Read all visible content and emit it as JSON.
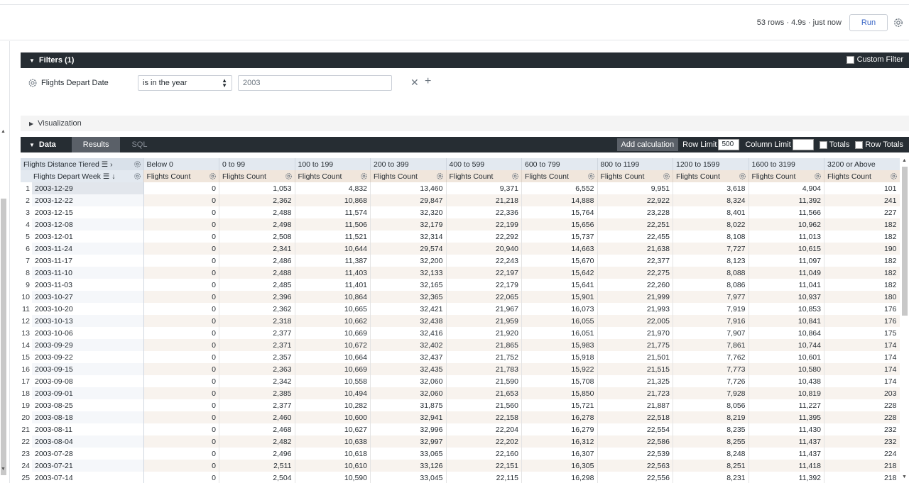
{
  "toolbar": {
    "status": "53 rows · 4.9s · just now",
    "run_label": "Run"
  },
  "filters": {
    "title": "Filters (1)",
    "custom_filter_label": "Custom Filter",
    "field_label": "Flights Depart Date",
    "operator": "is in the year",
    "value": "2003"
  },
  "visualization": {
    "title": "Visualization"
  },
  "data_panel": {
    "title": "Data",
    "tabs": [
      "Results",
      "SQL"
    ],
    "add_calculation": "Add calculation",
    "row_limit_label": "Row Limit",
    "row_limit_value": "500",
    "column_limit_label": "Column Limit",
    "column_limit_value": "",
    "totals_label": "Totals",
    "row_totals_label": "Row Totals"
  },
  "table": {
    "pivot_dimension": "Flights Distance Tiered",
    "row_dimension": "Flights Depart Week",
    "pivot_columns": [
      "Below 0",
      "0 to 99",
      "100 to 199",
      "200 to 399",
      "400 to 599",
      "600 to 799",
      "800 to 1199",
      "1200 to 1599",
      "1600 to 3199",
      "3200 or Above"
    ],
    "measure": "Flights Count",
    "rows": [
      {
        "i": "1",
        "week": "2003-12-29",
        "v": [
          "0",
          "1,053",
          "4,832",
          "13,460",
          "9,371",
          "6,552",
          "9,951",
          "3,618",
          "4,904",
          "101"
        ]
      },
      {
        "i": "2",
        "week": "2003-12-22",
        "v": [
          "0",
          "2,362",
          "10,868",
          "29,847",
          "21,218",
          "14,888",
          "22,922",
          "8,324",
          "11,392",
          "241"
        ]
      },
      {
        "i": "3",
        "week": "2003-12-15",
        "v": [
          "0",
          "2,488",
          "11,574",
          "32,320",
          "22,336",
          "15,764",
          "23,228",
          "8,401",
          "11,566",
          "227"
        ]
      },
      {
        "i": "4",
        "week": "2003-12-08",
        "v": [
          "0",
          "2,498",
          "11,506",
          "32,179",
          "22,199",
          "15,656",
          "22,251",
          "8,022",
          "10,962",
          "182"
        ]
      },
      {
        "i": "5",
        "week": "2003-12-01",
        "v": [
          "0",
          "2,508",
          "11,521",
          "32,314",
          "22,292",
          "15,737",
          "22,455",
          "8,108",
          "11,013",
          "182"
        ]
      },
      {
        "i": "6",
        "week": "2003-11-24",
        "v": [
          "0",
          "2,341",
          "10,644",
          "29,574",
          "20,940",
          "14,663",
          "21,638",
          "7,727",
          "10,615",
          "190"
        ]
      },
      {
        "i": "7",
        "week": "2003-11-17",
        "v": [
          "0",
          "2,486",
          "11,387",
          "32,200",
          "22,243",
          "15,670",
          "22,377",
          "8,123",
          "11,097",
          "182"
        ]
      },
      {
        "i": "8",
        "week": "2003-11-10",
        "v": [
          "0",
          "2,488",
          "11,403",
          "32,133",
          "22,197",
          "15,642",
          "22,275",
          "8,088",
          "11,049",
          "182"
        ]
      },
      {
        "i": "9",
        "week": "2003-11-03",
        "v": [
          "0",
          "2,485",
          "11,401",
          "32,165",
          "22,179",
          "15,641",
          "22,260",
          "8,086",
          "11,041",
          "182"
        ]
      },
      {
        "i": "10",
        "week": "2003-10-27",
        "v": [
          "0",
          "2,396",
          "10,864",
          "32,365",
          "22,065",
          "15,901",
          "21,999",
          "7,977",
          "10,937",
          "180"
        ]
      },
      {
        "i": "11",
        "week": "2003-10-20",
        "v": [
          "0",
          "2,362",
          "10,665",
          "32,421",
          "21,967",
          "16,073",
          "21,993",
          "7,919",
          "10,853",
          "176"
        ]
      },
      {
        "i": "12",
        "week": "2003-10-13",
        "v": [
          "0",
          "2,318",
          "10,662",
          "32,438",
          "21,959",
          "16,055",
          "22,005",
          "7,916",
          "10,841",
          "176"
        ]
      },
      {
        "i": "13",
        "week": "2003-10-06",
        "v": [
          "0",
          "2,377",
          "10,669",
          "32,416",
          "21,920",
          "16,051",
          "21,970",
          "7,907",
          "10,864",
          "175"
        ]
      },
      {
        "i": "14",
        "week": "2003-09-29",
        "v": [
          "0",
          "2,371",
          "10,672",
          "32,402",
          "21,865",
          "15,983",
          "21,775",
          "7,861",
          "10,744",
          "174"
        ]
      },
      {
        "i": "15",
        "week": "2003-09-22",
        "v": [
          "0",
          "2,357",
          "10,664",
          "32,437",
          "21,752",
          "15,918",
          "21,501",
          "7,762",
          "10,601",
          "174"
        ]
      },
      {
        "i": "16",
        "week": "2003-09-15",
        "v": [
          "0",
          "2,363",
          "10,669",
          "32,435",
          "21,783",
          "15,922",
          "21,515",
          "7,773",
          "10,580",
          "174"
        ]
      },
      {
        "i": "17",
        "week": "2003-09-08",
        "v": [
          "0",
          "2,342",
          "10,558",
          "32,060",
          "21,590",
          "15,708",
          "21,325",
          "7,726",
          "10,438",
          "174"
        ]
      },
      {
        "i": "18",
        "week": "2003-09-01",
        "v": [
          "0",
          "2,385",
          "10,494",
          "32,060",
          "21,653",
          "15,850",
          "21,723",
          "7,928",
          "10,819",
          "203"
        ]
      },
      {
        "i": "19",
        "week": "2003-08-25",
        "v": [
          "0",
          "2,377",
          "10,282",
          "31,875",
          "21,560",
          "15,721",
          "21,887",
          "8,056",
          "11,227",
          "228"
        ]
      },
      {
        "i": "20",
        "week": "2003-08-18",
        "v": [
          "0",
          "2,460",
          "10,600",
          "32,941",
          "22,158",
          "16,278",
          "22,518",
          "8,219",
          "11,395",
          "228"
        ]
      },
      {
        "i": "21",
        "week": "2003-08-11",
        "v": [
          "0",
          "2,468",
          "10,627",
          "32,996",
          "22,204",
          "16,279",
          "22,554",
          "8,235",
          "11,430",
          "232"
        ]
      },
      {
        "i": "22",
        "week": "2003-08-04",
        "v": [
          "0",
          "2,482",
          "10,638",
          "32,997",
          "22,202",
          "16,312",
          "22,586",
          "8,255",
          "11,437",
          "232"
        ]
      },
      {
        "i": "23",
        "week": "2003-07-28",
        "v": [
          "0",
          "2,496",
          "10,618",
          "33,065",
          "22,160",
          "16,307",
          "22,539",
          "8,248",
          "11,437",
          "224"
        ]
      },
      {
        "i": "24",
        "week": "2003-07-21",
        "v": [
          "0",
          "2,511",
          "10,610",
          "33,126",
          "22,151",
          "16,305",
          "22,563",
          "8,251",
          "11,418",
          "218"
        ]
      },
      {
        "i": "25",
        "week": "2003-07-14",
        "v": [
          "0",
          "2,504",
          "10,590",
          "33,045",
          "22,115",
          "16,298",
          "22,556",
          "8,231",
          "11,392",
          "218"
        ]
      }
    ]
  }
}
